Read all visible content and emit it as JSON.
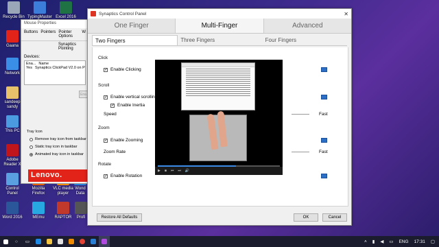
{
  "desktop": {
    "icons": [
      {
        "label": "Recycle Bin",
        "color": "#9aa7b8"
      },
      {
        "label": "TypingMaster",
        "color": "#3b7dd8"
      },
      {
        "label": "Excel 2016",
        "color": "#1f7244"
      },
      {
        "label": "Gaana",
        "color": "#e2231a"
      },
      {
        "label": "Network",
        "color": "#3a8ee6"
      },
      {
        "label": "sandeep sandy",
        "color": "#e8c26a"
      },
      {
        "label": "This PC",
        "color": "#4a9be0"
      },
      {
        "label": "Adobe Reader X",
        "color": "#c0151b"
      },
      {
        "label": "Control Panel",
        "color": "#5aa0e0"
      },
      {
        "label": "Mozilla Firefox",
        "color": "#e66000"
      },
      {
        "label": "VLC media player",
        "color": "#f08a00"
      },
      {
        "label": "Wond Data",
        "color": "#2a7fd4"
      },
      {
        "label": "Word 2016",
        "color": "#2b579a"
      },
      {
        "label": "MEmu",
        "color": "#27a8e0"
      },
      {
        "label": "RAPTOR",
        "color": "#c0392b"
      },
      {
        "label": "Profi",
        "color": "#555"
      }
    ]
  },
  "mouse_window": {
    "title": "Mouse Properties",
    "tabs": [
      "Buttons",
      "Pointers",
      "Pointer Options",
      "W"
    ],
    "subtitle": "Synaptics Pointing",
    "devices_label": "Devices:",
    "devices_headers": [
      "Ena...",
      "Name"
    ],
    "devices_rows": [
      [
        "Yes",
        "Synaptics ClickPad V2.0 on P"
      ]
    ],
    "enable_button": "Ena",
    "tray_label": "Tray Icon",
    "tray_options": [
      {
        "label": "Remove tray icon from taskbar",
        "selected": false
      },
      {
        "label": "Static tray icon in taskbar",
        "selected": false
      },
      {
        "label": "Animated tray icon in taskbar",
        "selected": true
      }
    ],
    "brand": "Lenovo."
  },
  "synaptics": {
    "title": "Synaptics Control Panel",
    "main_tabs": [
      "One Finger",
      "Multi-Finger",
      "Advanced"
    ],
    "active_main_tab": 1,
    "sub_tabs": [
      "Two Fingers",
      "Three Fingers",
      "Four Fingers"
    ],
    "active_sub_tab": 0,
    "sections": {
      "click": "Click",
      "enable_clicking": "Enable Clicking",
      "scroll": "Scroll",
      "enable_vertical_scrolling": "Enable vertical scrolling",
      "enable_inertia": "Enable Inertia",
      "speed": "Speed",
      "speed_max": "Fast",
      "zoom": "Zoom",
      "enable_zooming": "Enable Zooming",
      "zoom_rate": "Zoom Rate",
      "zoom_rate_max": "Fast",
      "rotate": "Rotate",
      "enable_rotation": "Enable Rotation"
    },
    "buttons": {
      "restore": "Restore All Defaults",
      "ok": "OK",
      "cancel": "Cancel"
    },
    "video": {
      "progress": 0.64
    }
  },
  "taskbar": {
    "apps": [
      {
        "name": "start-icon",
        "color": "#ffffff"
      },
      {
        "name": "search-icon",
        "color": "#ffffff"
      },
      {
        "name": "task-view-icon",
        "color": "#ffffff"
      },
      {
        "name": "edge-icon",
        "color": "#1e88e5"
      },
      {
        "name": "folder-icon",
        "color": "#f4c542"
      },
      {
        "name": "store-icon",
        "color": "#e0e0e0"
      },
      {
        "name": "vlc-icon",
        "color": "#f08a00"
      },
      {
        "name": "chrome-icon",
        "color": "#e34133"
      },
      {
        "name": "mail-icon",
        "color": "#2a7fd4"
      },
      {
        "name": "synaptics-icon",
        "color": "#b04ae0"
      }
    ],
    "language": "ENG",
    "time": "17:31"
  }
}
